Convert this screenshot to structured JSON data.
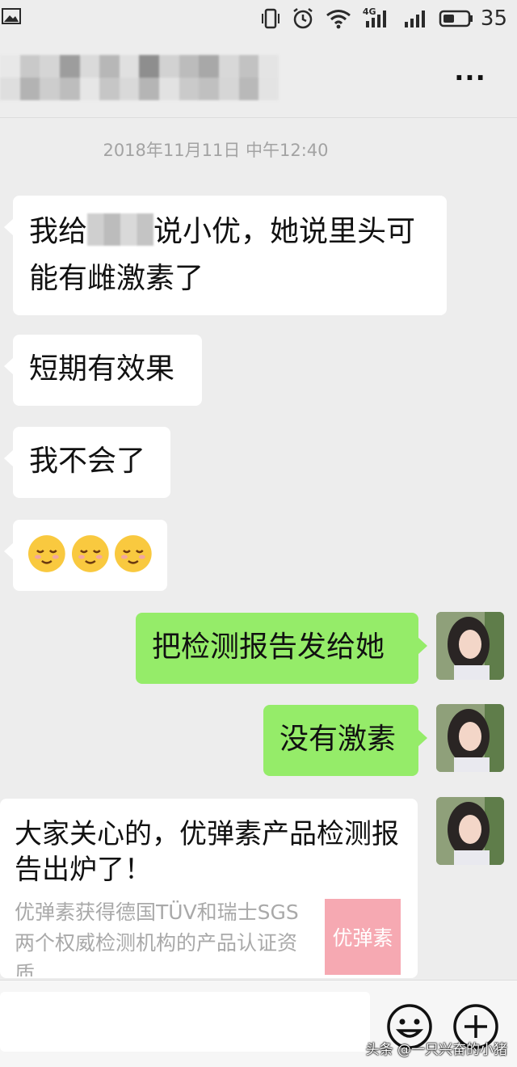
{
  "status_bar": {
    "battery": "35",
    "network": "4G"
  },
  "header": {
    "title_obscured": true,
    "more_icon": "more-icon",
    "more_label": "···"
  },
  "chat": {
    "timestamp": "2018年11月11日 中午12:40",
    "messages": [
      {
        "side": "in",
        "before_censor": "我给",
        "after_censor": "说小优，她说里头可",
        "line2": "能有雌激素了"
      },
      {
        "side": "in",
        "text": "短期有效果"
      },
      {
        "side": "in",
        "text": "我不会了"
      },
      {
        "side": "in",
        "emoji": "relieved-face-icon",
        "count": 3
      },
      {
        "side": "out",
        "text": "把检测报告发给她"
      },
      {
        "side": "out",
        "text": "没有激素"
      }
    ],
    "link_card": {
      "title": "大家关心的，优弹素产品检测报告出炉了！",
      "description": "优弹素获得德国TÜV和瑞士SGS两个权威检测机构的产品认证资质",
      "thumb_text": "优弹素"
    }
  },
  "input_bar": {
    "emoji_icon": "emoji-icon",
    "plus_icon": "plus-icon"
  },
  "watermark": "头条 @一只兴奋的小猪",
  "colors": {
    "background": "#ededed",
    "outgoing_bubble": "#95ec69",
    "incoming_bubble": "#ffffff",
    "thumb_background": "#f6a9b2"
  }
}
